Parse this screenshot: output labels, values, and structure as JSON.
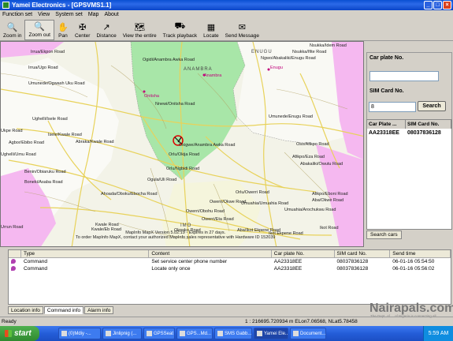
{
  "window": {
    "title": "Yamei Electronics - [GPSVMS1.1]",
    "controls": [
      "minimize",
      "maximize",
      "close"
    ]
  },
  "menu": [
    "Function set",
    "View",
    "System set",
    "Map",
    "About"
  ],
  "toolbar": [
    {
      "label": "Zoom in",
      "icon": "zoom-in-icon",
      "glyph": "🔍"
    },
    {
      "label": "Zoom out",
      "icon": "zoom-out-icon",
      "glyph": "🔍"
    },
    {
      "label": "Pan",
      "icon": "hand-icon",
      "glyph": "✋"
    },
    {
      "label": "Center",
      "icon": "center-icon",
      "glyph": "✠"
    },
    {
      "label": "Distance",
      "icon": "distance-icon",
      "glyph": "↗"
    },
    {
      "label": "View the entire",
      "icon": "view-entire-icon",
      "glyph": "🗺"
    },
    {
      "label": "Track playback",
      "icon": "track-playback-icon",
      "glyph": "⛟"
    },
    {
      "label": "Locate",
      "icon": "locate-icon",
      "glyph": "▦"
    },
    {
      "label": "Send Message",
      "icon": "send-message-icon",
      "glyph": "✉"
    }
  ],
  "map": {
    "labels": [
      "Nsukka/Idem Road",
      "Nsukka/Ifite Road",
      "Irrua/Ekpon Road",
      "Ngwo/Abakaliki/Enugu Road",
      "Ogidi/Anambra Awka Road",
      "Enugu",
      "Irrua/Ugo Road",
      "Umunede/Ogwash Uku Road",
      "Onitsha",
      "Anambra",
      "Nnewi/Onitsha Road",
      "Ughelli/Isele Road",
      "Ukpe Road",
      "Agbor/Ebibo Road",
      "Umunede/Enugu Road",
      "Isele/Kwale Road",
      "Abraka/Kwale Road",
      "Orlu/Okija Road",
      "Okigwe/Anambra Awka Road",
      "Oso/Afikpo Road",
      "Afikpo/Eza Road",
      "Abakaliki/Owutu Road",
      "Orlu/Ngbidi Road",
      "Ughelli/Umu Road",
      "Benin/Obiaruku Road",
      "Ogula/Uli Road",
      "Boneki/Asaba Road",
      "Ahoada/Oboku/Ebocha Road",
      "Orlu/Owerri Road",
      "Afikpo/Eboni Road",
      "Owerri/Okwe Road",
      "Umuahia/Umuahia Road",
      "Aba/Okwe Road",
      "Umuahia/Arochukwu Road",
      "Owerri/Obohu Road",
      "Owerri/Eta Road",
      "Urrun Road",
      "Kwale/Eb Road",
      "Kwale Road",
      "Okpoko Road",
      "Aba/Ikot Ekpene Road",
      "Ikot Road",
      "Ikot Ekpene Road"
    ],
    "region_labels": [
      "ENUGU",
      "ANAMBRA",
      "IMO"
    ],
    "city_labels": [
      "Onitsha",
      "Anambra",
      "Enugu"
    ],
    "note_line1": "MapInfo MapX Version 5.02.19 - Expires in 27 days.",
    "note_line2": "To order MapInfo MapX, contact your authorized MapInfo sales representative with Hardware ID 152039"
  },
  "side_panel": {
    "car_plate_label": "Car plate No.",
    "car_plate_value": "",
    "sim_card_label": "SIM Card No.",
    "sim_card_value": "8",
    "search_button": "Search",
    "results_headers": [
      "Car Plate ...",
      "SIM Card No."
    ],
    "results": [
      {
        "plate": "AA23318EE",
        "sim": "08037836128"
      }
    ],
    "tab": "Search cars"
  },
  "command_grid": {
    "headers": [
      "Type",
      "Content",
      "Car plate No.",
      "SIM card No.",
      "Send time"
    ],
    "rows": [
      {
        "type": "Command",
        "content": "Set service center phone number",
        "plate": "AA23318EE",
        "sim": "08037836128",
        "time": "06-01-16 05:54:50"
      },
      {
        "type": "Command",
        "content": "Locate only once",
        "plate": "AA23318EE",
        "sim": "08037836128",
        "time": "06-01-16 05:56:02"
      }
    ]
  },
  "bottom_tabs": [
    "Location info",
    "Command info",
    "Alarm info"
  ],
  "status": {
    "left": "Ready",
    "coords": "1 : 216695.720934 m  ELon7.06568, NLat5.78458"
  },
  "watermark": {
    "text": "Nairapals.com",
    "sub": "The Dept. of ... of Nigeria is connecting all"
  },
  "taskbar": {
    "start": "start",
    "tasks": [
      "(0)Mdiy -...",
      "Jinlipnig (...",
      "GPSSeat",
      "GPS...Md...",
      "SMS Gabb...",
      "Yamei Ele...",
      "Document..."
    ],
    "active_task_index": 5,
    "clock": "5:59 AM"
  },
  "colors": {
    "map_green": "#a8e6a8",
    "map_pink": "#f5b8f0",
    "road_yellow": "#e8d25a",
    "road_grey": "#a0a0a0"
  }
}
